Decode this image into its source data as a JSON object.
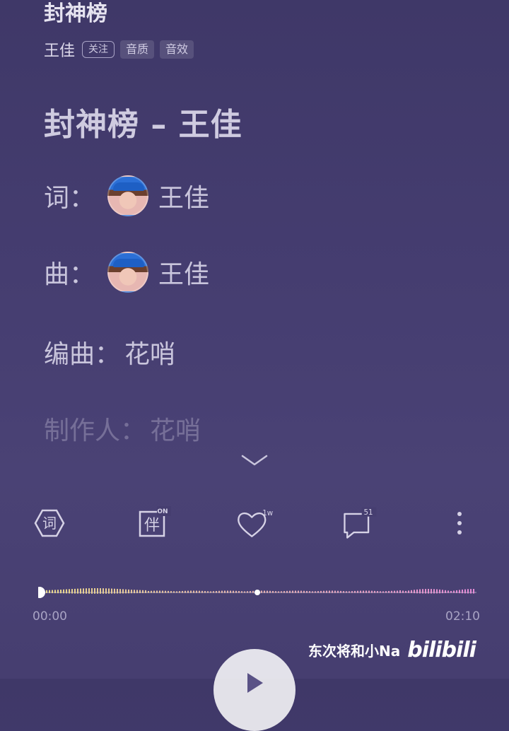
{
  "header": {
    "song_title": "封神榜",
    "artist": "王佳",
    "tags": {
      "follow": "关注",
      "quality": "音质",
      "effect": "音效"
    }
  },
  "lyrics": {
    "heading": "封神榜 – 王佳",
    "credits": [
      {
        "role": "词：",
        "name": "王佳",
        "has_avatar": true
      },
      {
        "role": "曲：",
        "name": "王佳",
        "has_avatar": true
      },
      {
        "role": "编曲：",
        "name": "花哨",
        "has_avatar": false
      },
      {
        "role": "制作人：",
        "name": "花哨",
        "has_avatar": false
      }
    ]
  },
  "actions": {
    "lyrics_icon_label": "词",
    "accompany_icon_label": "伴",
    "accompany_state": "ON",
    "like_count": "1w",
    "comment_count": "51"
  },
  "player": {
    "current_time": "00:00",
    "total_time": "02:10",
    "progress": 0.0,
    "marker_position": 0.5
  },
  "watermark": {
    "uploader": "东次将和小Na",
    "logo": "bilibili"
  },
  "colors": {
    "background_top": "#3f3868",
    "background_bottom": "#4a4275",
    "wave_left": "#e8d98a",
    "wave_right": "#e48ad6"
  }
}
